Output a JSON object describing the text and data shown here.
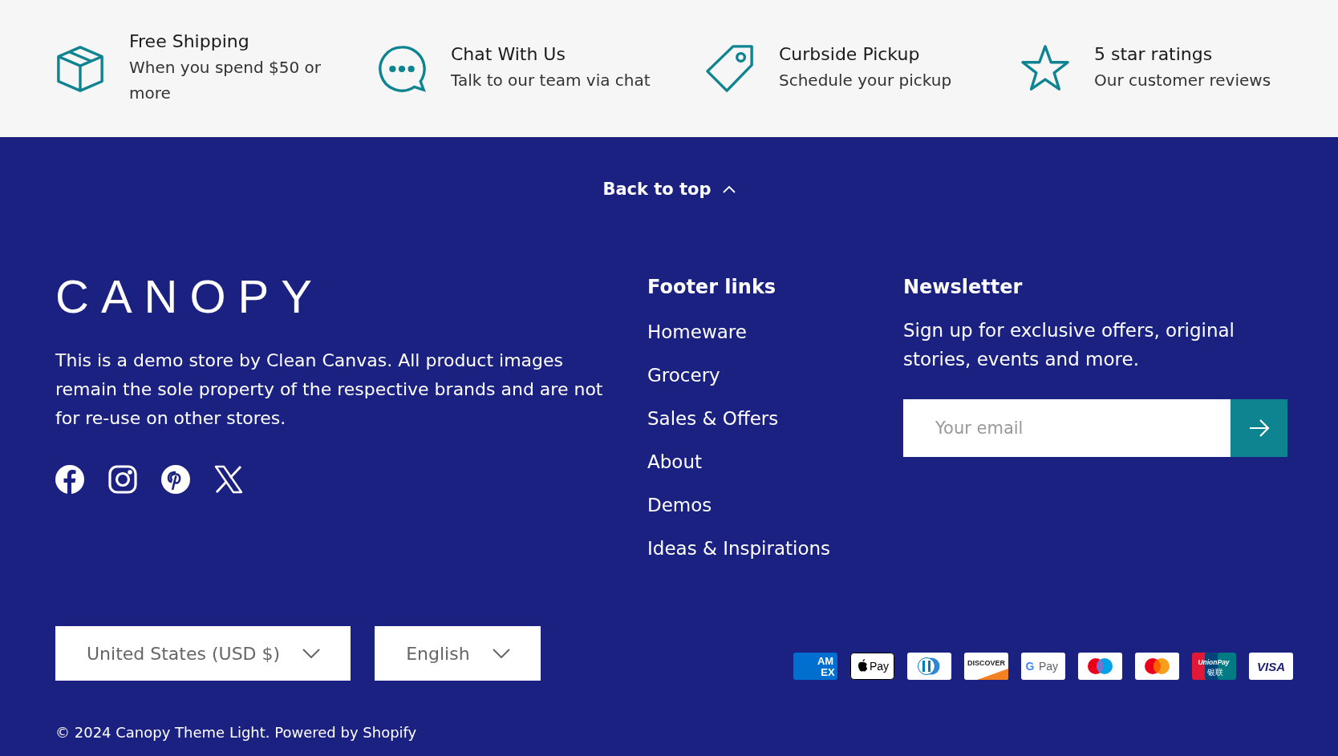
{
  "features": [
    {
      "kind": "box",
      "title": "Free Shipping",
      "text": "When you spend $50 or more"
    },
    {
      "kind": "chat",
      "title": "Chat With Us",
      "text": "Talk to our team via chat"
    },
    {
      "kind": "tag",
      "title": "Curbside Pickup",
      "text": "Schedule your pickup"
    },
    {
      "kind": "star",
      "title": "5 star ratings",
      "text": "Our customer reviews"
    }
  ],
  "back_to_top": "Back to top",
  "brand": {
    "logo": "CANOPY",
    "description": "This is a demo store by Clean Canvas. All product images remain the sole property of the respective brands and are not for re-use on other stores.",
    "social": [
      {
        "kind": "facebook"
      },
      {
        "kind": "instagram"
      },
      {
        "kind": "pinterest"
      },
      {
        "kind": "x"
      }
    ]
  },
  "footer_links": {
    "heading": "Footer links",
    "items": [
      "Homeware",
      "Grocery",
      "Sales & Offers",
      "About",
      "Demos",
      "Ideas & Inspirations"
    ]
  },
  "newsletter": {
    "heading": "Newsletter",
    "text": "Sign up for exclusive offers, original stories, events and more.",
    "placeholder": "Your email"
  },
  "selectors": [
    {
      "value": "United States (USD $)"
    },
    {
      "value": "English"
    }
  ],
  "payments": [
    {
      "kind": "amex",
      "labels": [
        "AM",
        "EX"
      ]
    },
    {
      "kind": "applepay",
      "labels": [
        "Pay"
      ]
    },
    {
      "kind": "diners"
    },
    {
      "kind": "discover",
      "labels": [
        "DISCOVER"
      ]
    },
    {
      "kind": "gpay",
      "labels": [
        "G",
        "Pay"
      ]
    },
    {
      "kind": "maestro"
    },
    {
      "kind": "mastercard"
    },
    {
      "kind": "unionpay",
      "labels": [
        "UnionPay",
        "银联"
      ]
    },
    {
      "kind": "visa",
      "labels": [
        "VISA"
      ]
    }
  ],
  "copyright": "© 2024 Canopy Theme Light. Powered by Shopify"
}
